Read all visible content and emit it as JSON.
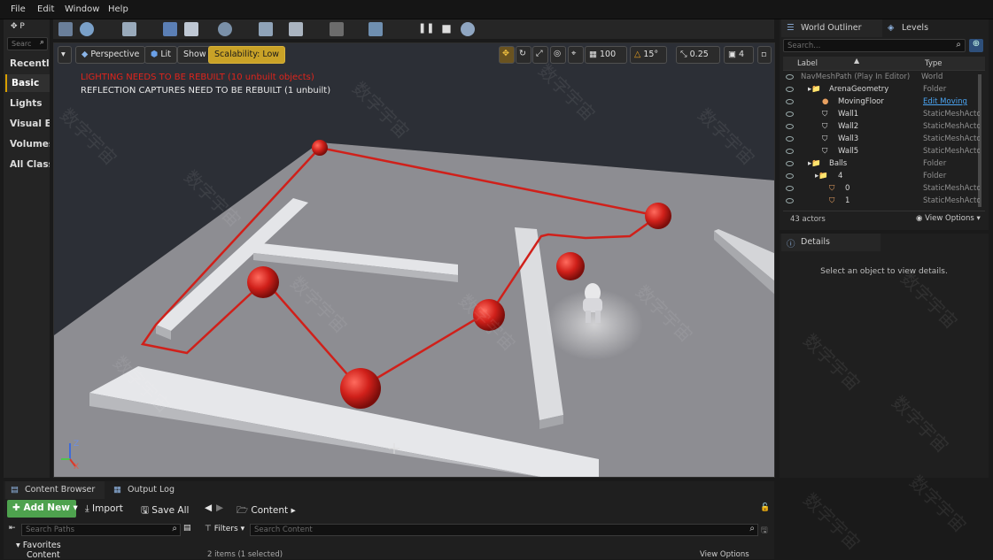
{
  "menu": [
    "File",
    "Edit",
    "Window",
    "Help"
  ],
  "modes": {
    "search_placeholder": "Searc",
    "header": "P",
    "items": [
      {
        "label": "Recently"
      },
      {
        "label": "Basic"
      },
      {
        "label": "Lights"
      },
      {
        "label": "Visual Eff"
      },
      {
        "label": "Volumes"
      },
      {
        "label": "All Classe"
      }
    ]
  },
  "viewport": {
    "perspective": "Perspective",
    "lit": "Lit",
    "show": "Show",
    "scalability": "Scalability: Low",
    "grid_snap": "100",
    "rotation_snap": "15°",
    "scale_snap": "0.25",
    "camera_speed": "4",
    "warnings": {
      "lighting": "LIGHTING NEEDS TO BE REBUILT (10 unbuilt objects)",
      "reflection": "REFLECTION CAPTURES NEED TO BE REBUILT (1 unbuilt)"
    },
    "axis": {
      "z": "Z",
      "x": "X"
    }
  },
  "outliner": {
    "tab_outliner": "World Outliner",
    "tab_levels": "Levels",
    "search_placeholder": "Search...",
    "col_label": "Label",
    "col_type": "Type",
    "rows": [
      {
        "label": "NavMeshPath (Play In Editor)",
        "type": "World"
      },
      {
        "label": "ArenaGeometry",
        "type": "Folder"
      },
      {
        "label": "MovingFloor",
        "type": "Edit Moving"
      },
      {
        "label": "Wall1",
        "type": "StaticMeshActor"
      },
      {
        "label": "Wall2",
        "type": "StaticMeshActor"
      },
      {
        "label": "Wall3",
        "type": "StaticMeshActor"
      },
      {
        "label": "Wall5",
        "type": "StaticMeshActor"
      },
      {
        "label": "Balls",
        "type": "Folder"
      },
      {
        "label": "4",
        "type": "Folder"
      },
      {
        "label": "0",
        "type": "StaticMeshActor"
      },
      {
        "label": "1",
        "type": "StaticMeshActor"
      }
    ],
    "actor_count": "43 actors",
    "view_options": "View Options"
  },
  "details": {
    "tab": "Details",
    "empty": "Select an object to view details."
  },
  "content_browser": {
    "tab": "Content Browser",
    "tab_output": "Output Log",
    "add_new": "Add New",
    "import": "Import",
    "save_all": "Save All",
    "path": "Content",
    "search_paths": "Search Paths",
    "filters": "Filters",
    "search_content": "Search Content",
    "favorites": "Favorites",
    "content_folder": "Content",
    "items_selected": "2 items (1 selected)",
    "view_options": "View Options"
  },
  "watermark": "数字宇宙",
  "colors": {
    "accent_red": "#d0201a",
    "add_new_green": "#4ea24e",
    "scalability_yellow": "#c9a227",
    "link_blue": "#4aa3f0"
  }
}
